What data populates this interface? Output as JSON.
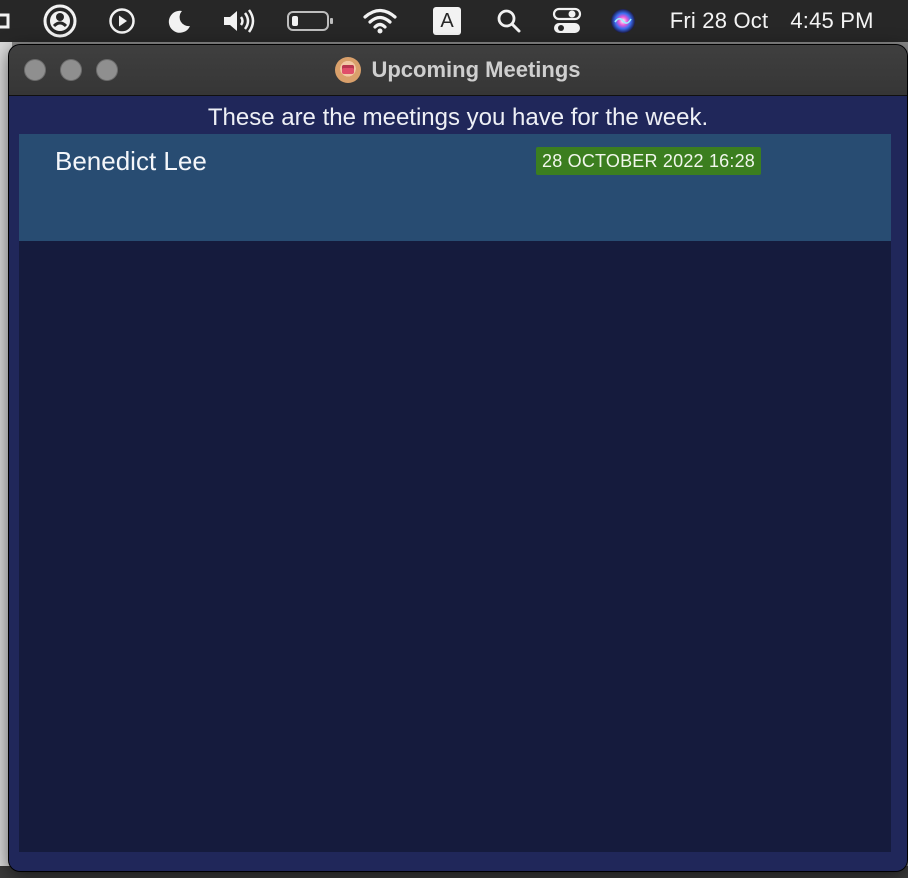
{
  "menubar": {
    "icons": [
      {
        "name": "accessibility-icon"
      },
      {
        "name": "play-icon"
      },
      {
        "name": "moon-icon"
      },
      {
        "name": "volume-icon"
      },
      {
        "name": "battery-icon"
      },
      {
        "name": "wifi-icon"
      },
      {
        "name": "input-source-icon",
        "label": "A"
      },
      {
        "name": "search-icon"
      },
      {
        "name": "control-center-icon"
      },
      {
        "name": "siri-icon"
      }
    ],
    "date": "Fri 28 Oct",
    "time": "4:45 PM"
  },
  "window": {
    "title": "Upcoming Meetings",
    "app_icon": "calendar-icon",
    "traffic_lights": [
      "close",
      "minimize",
      "zoom"
    ],
    "subtitle": "These are the meetings you have for the week.",
    "meetings": [
      {
        "name": "Benedict Lee",
        "datetime": "28 OCTOBER 2022 16:28"
      }
    ]
  },
  "colors": {
    "menubar": "#272727",
    "titlebar": "#3a3a3a",
    "content_bg": "#20275a",
    "list_bg": "#151b3d",
    "row_bg": "#284c72",
    "date_badge": "#3b7e1f"
  }
}
